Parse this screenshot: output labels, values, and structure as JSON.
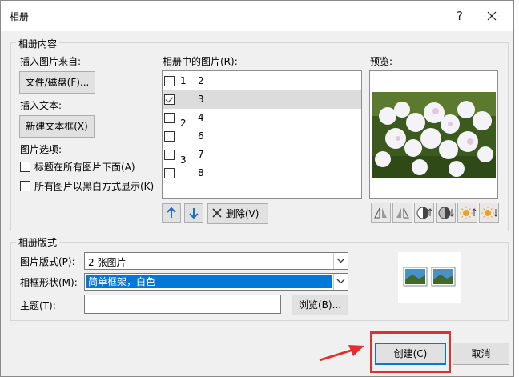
{
  "window": {
    "title": "相册",
    "help_label": "?",
    "close_icon": "close-icon"
  },
  "content_group": {
    "title": "相册内容",
    "insert_from_label": "插入图片来自:",
    "file_button": "文件/磁盘(F)...",
    "insert_text_label": "插入文本:",
    "new_textbox_button": "新建文本框(X)",
    "picture_options_label": "图片选项:",
    "options": [
      {
        "label": "标题在所有图片下面(A)",
        "checked": false
      },
      {
        "label": "所有图片以黑白方式显示(K)",
        "checked": false
      }
    ],
    "list_label": "相册中的图片(R):",
    "pictures": [
      {
        "group": "1",
        "num": "2",
        "checked": false,
        "selected": false
      },
      {
        "group": "",
        "num": "3",
        "checked": true,
        "selected": true
      },
      {
        "group": "2",
        "num": "4",
        "checked": false,
        "selected": false
      },
      {
        "group": "",
        "num": "6",
        "checked": false,
        "selected": false
      },
      {
        "group": "3",
        "num": "7",
        "checked": false,
        "selected": false
      },
      {
        "group": "",
        "num": "8",
        "checked": false,
        "selected": false
      }
    ],
    "move_up_icon": "arrow-up-icon",
    "move_down_icon": "arrow-down-icon",
    "delete_button": "删除(V)",
    "preview_label": "预览:",
    "preview_tools": [
      "rotate-left-icon",
      "rotate-right-icon",
      "contrast-increase-icon",
      "contrast-decrease-icon",
      "brightness-increase-icon",
      "brightness-decrease-icon"
    ]
  },
  "layout_group": {
    "title": "相册版式",
    "picture_layout_label": "图片版式(P):",
    "picture_layout_value": "2 张图片",
    "frame_shape_label": "相框形状(M):",
    "frame_shape_value": "简单框架，白色",
    "theme_label": "主题(T):",
    "theme_value": "",
    "browse_button": "浏览(B)..."
  },
  "footer": {
    "create_button": "创建(C)",
    "cancel_button": "取消"
  },
  "colors": {
    "accent": "#0078d7",
    "annotation": "#e03030"
  }
}
